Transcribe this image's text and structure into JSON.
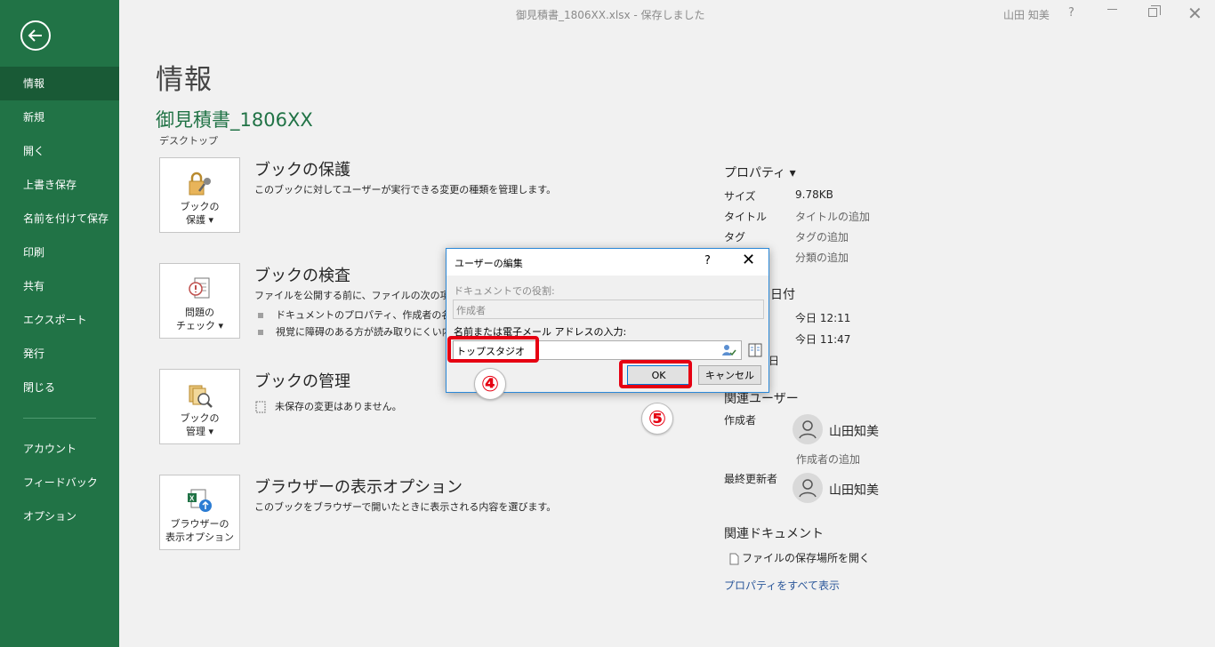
{
  "window": {
    "doc_title": "御見積書_1806XX.xlsx  -  保存しました",
    "user": "山田 知美",
    "help": "?",
    "min_label": "",
    "close": "✕"
  },
  "sidebar": {
    "items": [
      {
        "label": "情報"
      },
      {
        "label": "新規"
      },
      {
        "label": "開く"
      },
      {
        "label": "上書き保存"
      },
      {
        "label": "名前を付けて保存"
      },
      {
        "label": "印刷"
      },
      {
        "label": "共有"
      },
      {
        "label": "エクスポート"
      },
      {
        "label": "発行"
      },
      {
        "label": "閉じる"
      }
    ],
    "bottom_items": [
      {
        "label": "アカウント"
      },
      {
        "label": "フィードバック"
      },
      {
        "label": "オプション"
      }
    ]
  },
  "main": {
    "title": "情報",
    "file_name": "御見積書_1806XX",
    "file_location": "デスクトップ",
    "sections": {
      "protect": {
        "btn_line1": "ブックの",
        "btn_line2": "保護 ▾",
        "title": "ブックの保護",
        "desc": "このブックに対してユーザーが実行できる変更の種類を管理します。"
      },
      "inspect": {
        "btn_line1": "問題の",
        "btn_line2": "チェック ▾",
        "title": "ブックの検査",
        "desc": "ファイルを公開する前に、ファイルの次の項目を",
        "bullet1": "ドキュメントのプロパティ、作成者の名前、",
        "bullet2": "視覚に障碍のある方が読み取りにくい内"
      },
      "manage": {
        "btn_line1": "ブックの",
        "btn_line2": "管理 ▾",
        "title": "ブックの管理",
        "desc": "未保存の変更はありません。"
      },
      "browser": {
        "btn_line1": "ブラウザーの",
        "btn_line2": "表示オプション",
        "title": "ブラウザーの表示オプション",
        "desc": "このブックをブラウザーで開いたときに表示される内容を選びます。"
      }
    }
  },
  "properties": {
    "header": "プロパティ ▾",
    "rows": [
      {
        "key": "サイズ",
        "value": "9.78KB"
      },
      {
        "key": "タイトル",
        "value": "タイトルの追加"
      },
      {
        "key": "タグ",
        "value": "タグの追加"
      },
      {
        "key": "",
        "value": "分類の追加"
      }
    ],
    "dates_header_fragment": "日付",
    "dates": [
      {
        "value": "今日 12:11"
      },
      {
        "value": "今日 11:47"
      }
    ],
    "date_fragment": "日",
    "related_users_header": "関連ユーザー",
    "author_key": "作成者",
    "author_name": "山田知美",
    "add_author": "作成者の追加",
    "last_modified_key": "最終更新者",
    "last_modified_name": "山田知美",
    "related_docs_header": "関連ドキュメント",
    "open_location": "ファイルの保存場所を開く",
    "show_all": "プロパティをすべて表示"
  },
  "dialog": {
    "title": "ユーザーの編集",
    "help": "?",
    "close": "✕",
    "role_label": "ドキュメントでの役割:",
    "role_value": "作成者",
    "name_label": "名前または電子メール アドレスの入力:",
    "name_value": "トップスタジオ",
    "ok_label": "OK",
    "cancel_label": "キャンセル"
  },
  "annotations": {
    "step4": "④",
    "step5": "⑤"
  },
  "colors": {
    "accent": "#217346",
    "highlight": "#e60012",
    "link": "#2b579a"
  }
}
